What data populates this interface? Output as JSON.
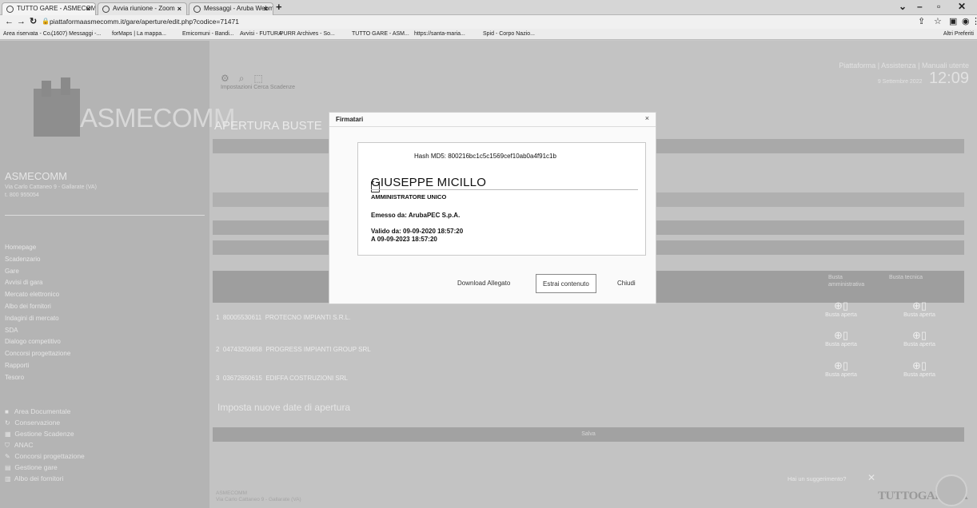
{
  "browser": {
    "tabs": [
      {
        "label": "TUTTO GARE - ASMECOMM"
      },
      {
        "label": "Avvia riunione - Zoom"
      },
      {
        "label": "Messaggi - Aruba Webmail"
      }
    ],
    "new_tab": "+",
    "window_buttons": [
      "⌄",
      "–",
      "▫",
      "✕"
    ],
    "url": "piattaformaasmecomm.it/gare/aperture/edit.php?codice=71471",
    "bookmarks": [
      "Area riservata - Co...",
      "(1607) Messaggi -...",
      "forMaps | La mappa...",
      "Emicomuni - Bandi...",
      "Avvisi - FUTURA",
      "PURR Archives - So...",
      "TUTTO GARE - ASM...",
      "https://santa-maria...",
      "Spid - Corpo Nazio..."
    ],
    "bookmarks_right": "Altri Preferiti"
  },
  "sidebar": {
    "logo_text": "ASMECOMM",
    "org_name": "ASMECOMM",
    "org_address": "Via Carlo Cattaneo 9 - Gallarate (VA)",
    "org_phone": "t. 800 955054",
    "menu": [
      "Homepage",
      "Scadenzario",
      "Gare",
      "Avvisi di gara",
      "Mercato elettronico",
      "Albo dei fornitori",
      "Indagini di mercato",
      "SDA",
      "Dialogo competitivo",
      "Concorsi progettazione",
      "Rapporti",
      "Tesoro"
    ],
    "menu2": [
      {
        "icon": "folder-icon",
        "glyph": "■",
        "label": "Area Documentale"
      },
      {
        "icon": "refresh-icon",
        "glyph": "↻",
        "label": "Conservazione"
      },
      {
        "icon": "calendar-icon",
        "glyph": "▦",
        "label": "Gestione Scadenze"
      },
      {
        "icon": "shield-icon",
        "glyph": "⛉",
        "label": "ANAC"
      },
      {
        "icon": "pencil-icon",
        "glyph": "✎",
        "label": "Concorsi progettazione"
      },
      {
        "icon": "briefcase-icon",
        "glyph": "▤",
        "label": "Gestione gare"
      },
      {
        "icon": "book-icon",
        "glyph": "▥",
        "label": "Albo dei fornitori"
      }
    ]
  },
  "main": {
    "top_icons": [
      "⚙",
      "⌕",
      "⬚"
    ],
    "top_icons_label": "Impostazioni  Cerca  Scadenze",
    "top_right_links": "Piattaforma | Assistenza | Manuali utente",
    "date": "9 Settembre 2022",
    "time": "12:09",
    "page_title": "APERTURA BUSTE",
    "table_headers": [
      "Busta amministrativa",
      "Busta tecnica"
    ],
    "rows": [
      {
        "num": "1",
        "code": "80005530611",
        "name": "PROTECNO IMPIANTI S.R.L."
      },
      {
        "num": "2",
        "code": "04743250858",
        "name": "PROGRESS IMPIANTI GROUP SRL"
      },
      {
        "num": "3",
        "code": "03672650615",
        "name": "EDIFFA COSTRUZIONI SRL"
      }
    ],
    "row_status": "Busta aperta",
    "new_dates_label": "Imposta nuove date di apertura",
    "green_bar_label": "Salva",
    "footer": "ASMECOMM\nVia Carlo Cattaneo 9 - Gallarate (VA)",
    "toast": "Hai un suggerimento?",
    "brand": "TUTTOGARE PA"
  },
  "modal": {
    "title": "Firmatari",
    "close": "×",
    "hash": "Hash MD5: 800216bc1c5c1569cef10ab0a4f91c1b",
    "signer": "GIUSEPPE MICILLO",
    "role": "AMMINISTRATORE UNICO",
    "issued_by": "Emesso da: ArubaPEC S.p.A.",
    "valid_from": "Valido da: 09-09-2020 18:57:20",
    "valid_to": "A 09-09-2023 18:57:20",
    "buttons": {
      "download": "Download Allegato",
      "extract": "Estrai contenuto",
      "close": "Chiudi"
    }
  }
}
